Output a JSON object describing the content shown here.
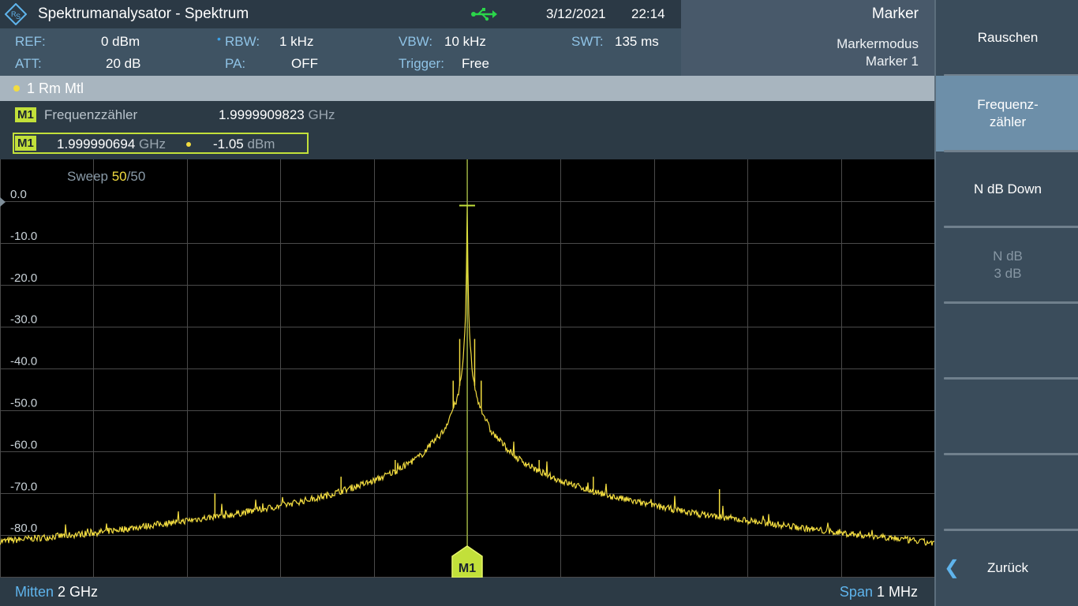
{
  "window": {
    "title": "Spektrumanalysator - Spektrum",
    "date": "3/12/2021",
    "time": "22:14",
    "icons": {
      "logo": "rs-logo-icon",
      "usb": "usb-icon"
    }
  },
  "marker_panel": {
    "title": "Marker",
    "mode": "Markermodus",
    "marker": "Marker 1"
  },
  "settings": {
    "ref_label": "REF:",
    "ref_value": "0 dBm",
    "att_label": "ATT:",
    "att_value": "20 dB",
    "rbw_label": "RBW:",
    "rbw_value": "1 kHz",
    "pa_label": "PA:",
    "pa_value": "OFF",
    "vbw_label": "VBW:",
    "vbw_value": "10 kHz",
    "trigger_label": "Trigger:",
    "trigger_value": "Free",
    "swt_label": "SWT:",
    "swt_value": "135 ms"
  },
  "trace": {
    "label": "1 Rm  Mtl",
    "color": "#f2dc40"
  },
  "marker_info": {
    "badge": "M1",
    "counter_label": "Frequenzzähler",
    "counter_value": "1.9999909823",
    "counter_unit": "GHz",
    "m1_freq": "1.999990694",
    "m1_freq_unit": "GHz",
    "m1_level": "-1.05",
    "m1_level_unit": "dBm"
  },
  "plot": {
    "sweep_label": "Sweep",
    "sweep_current": "50",
    "sweep_total": "/50",
    "y_ticks": [
      "0.0",
      "-10.0",
      "-20.0",
      "-30.0",
      "-40.0",
      "-50.0",
      "-60.0",
      "-70.0",
      "-80.0"
    ],
    "marker_label": "M1",
    "trace_color": "#f2dc40",
    "marker_color": "#c2e03a"
  },
  "bottom": {
    "center_label": "Mitten",
    "center_value": "2 GHz",
    "span_label": "Span",
    "span_value": "1 MHz"
  },
  "softkeys": [
    {
      "label": "Rauschen",
      "state": "normal"
    },
    {
      "label": "Frequenz-\nzähler",
      "state": "active"
    },
    {
      "label": "N dB Down",
      "state": "normal"
    },
    {
      "label": "N dB\n3 dB",
      "state": "disabled"
    },
    {
      "label": "",
      "state": "normal"
    },
    {
      "label": "",
      "state": "normal"
    },
    {
      "label": "",
      "state": "normal"
    },
    {
      "label": "Zurück",
      "state": "normal"
    }
  ],
  "chart_data": {
    "type": "line",
    "title": "",
    "xlabel": "",
    "ylabel": "",
    "x_center_ghz": 2.0,
    "x_span_mhz": 1.0,
    "ylim": [
      -85,
      5
    ],
    "y_unit": "dBm",
    "grid": true,
    "series": [
      {
        "x_offset_khz": [
          -500,
          -450,
          -400,
          -350,
          -300,
          -250,
          -200,
          -150,
          -100,
          -75,
          -50,
          -25,
          -10,
          -5,
          -2,
          -1,
          0,
          1,
          2,
          5,
          10,
          25,
          50,
          75,
          100,
          150,
          200,
          250,
          300,
          350,
          400,
          450,
          500
        ],
        "values": [
          -81.5,
          -80.5,
          -79.5,
          -78,
          -76.5,
          -75,
          -73,
          -70.5,
          -67,
          -64.5,
          -61,
          -55,
          -47,
          -40,
          -30,
          -20,
          -1.05,
          -20,
          -30,
          -40,
          -47,
          -55,
          -61,
          -64.5,
          -67,
          -70.5,
          -73,
          -75,
          -76.5,
          -78,
          -79.5,
          -80.5,
          -82
        ]
      }
    ],
    "marker": {
      "name": "M1",
      "x_offset_khz": -0.0093,
      "value": -1.05
    }
  }
}
